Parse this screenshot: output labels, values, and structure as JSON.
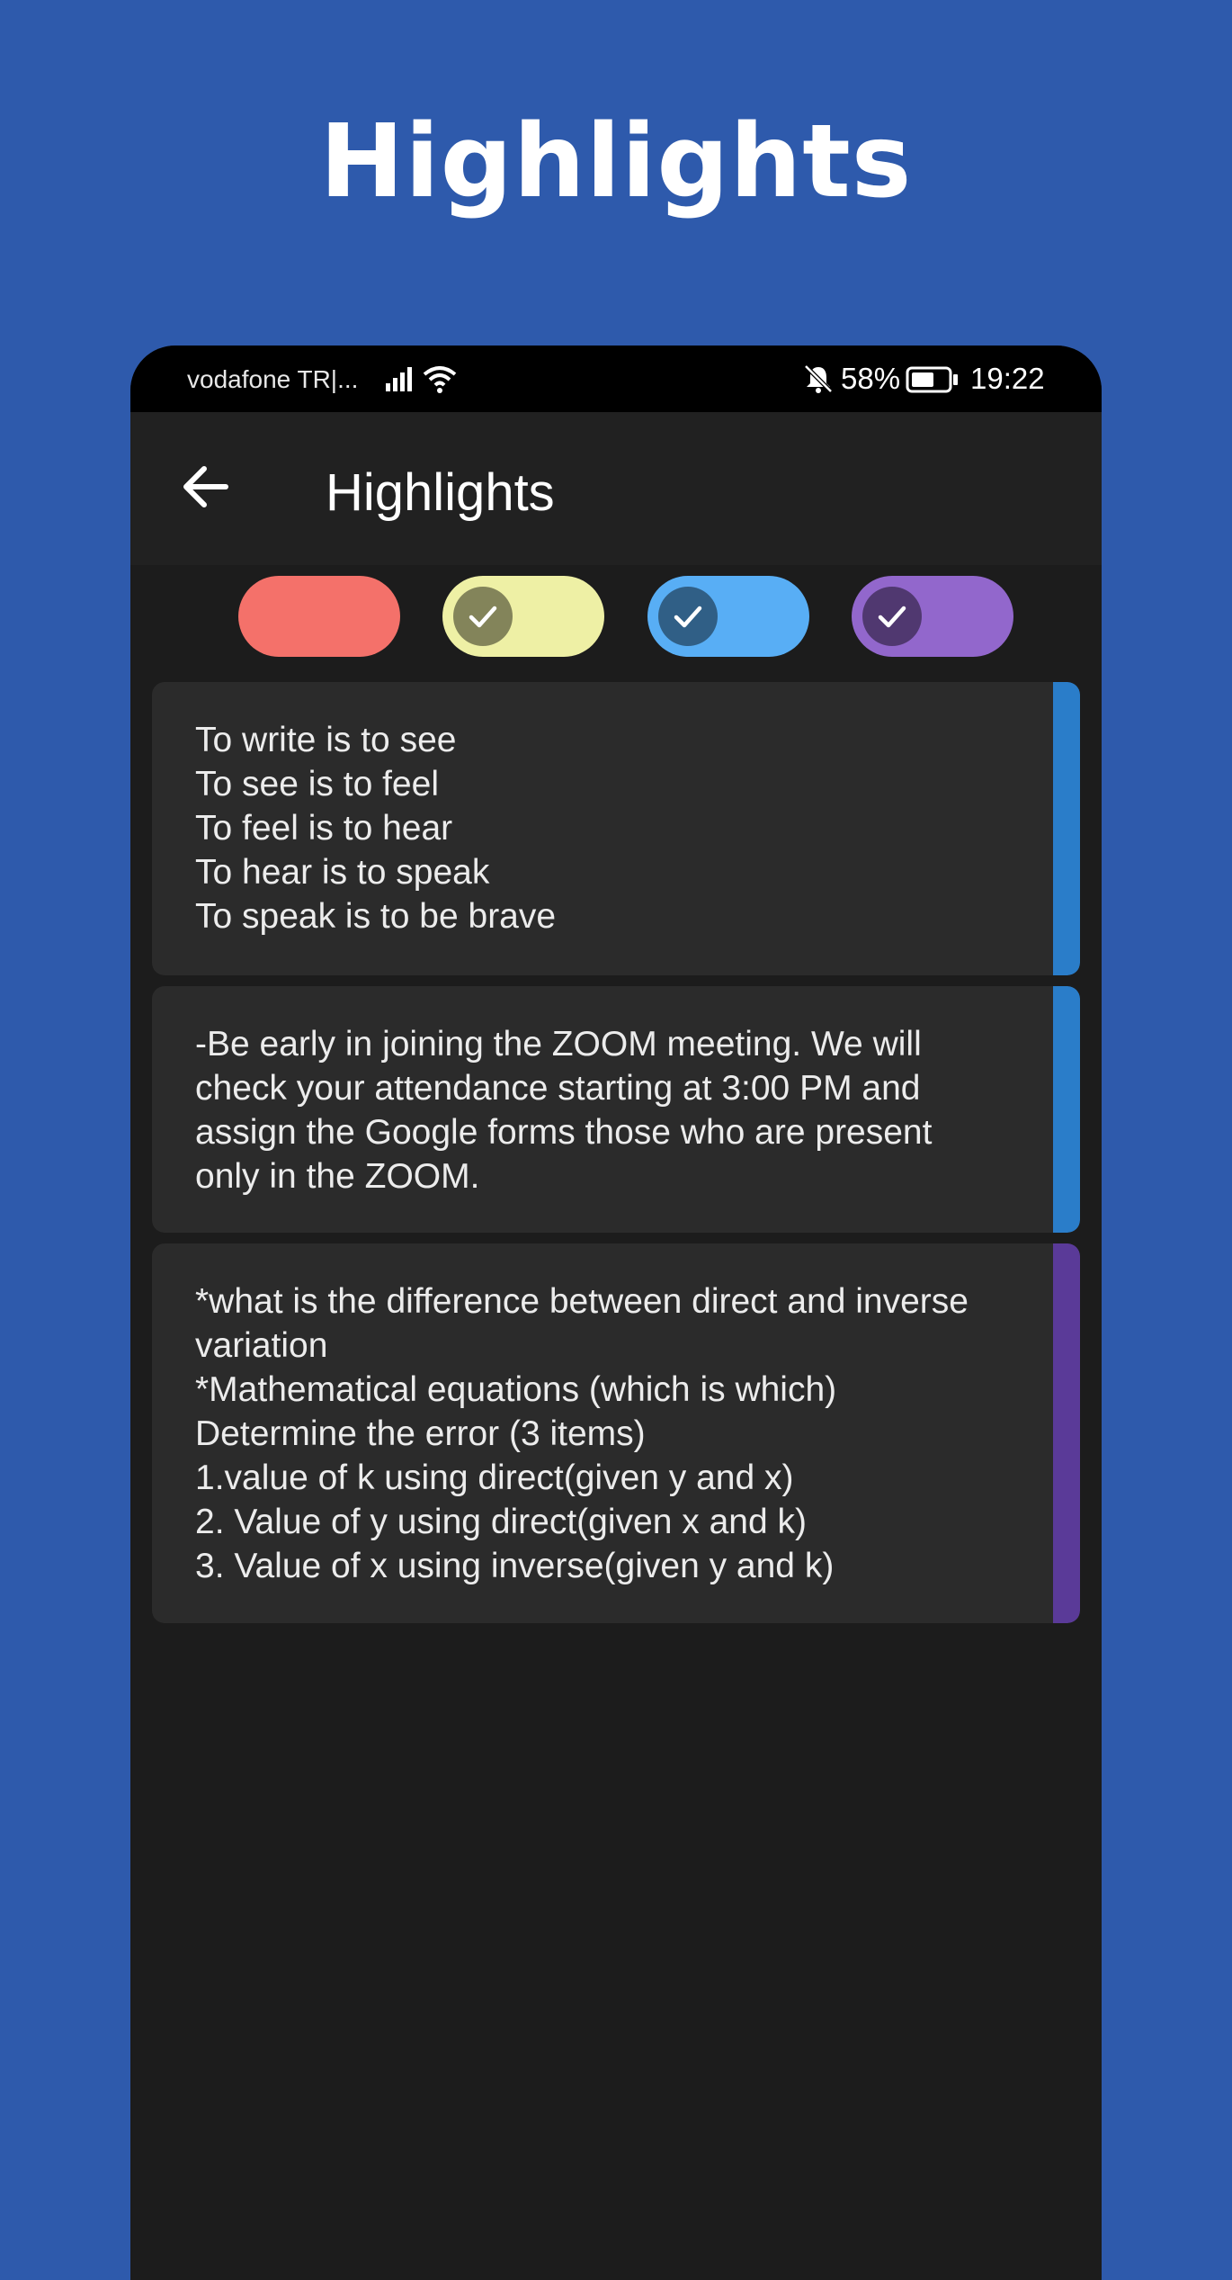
{
  "promo": {
    "title": "Highlights"
  },
  "status_bar": {
    "carrier": "vodafone TR|...",
    "battery": "58%",
    "time": "19:22",
    "icons": [
      "signal-icon",
      "wifi-icon",
      "bell-off-icon",
      "battery-icon"
    ]
  },
  "app_bar": {
    "title": "Highlights",
    "back_icon": "arrow-left-icon"
  },
  "color_filters": [
    {
      "name": "red",
      "color": "#f4716a",
      "selected": false
    },
    {
      "name": "yellow",
      "color": "#eef0a5",
      "selected": true
    },
    {
      "name": "blue",
      "color": "#58aef5",
      "selected": true
    },
    {
      "name": "purple",
      "color": "#9267cc",
      "selected": true
    }
  ],
  "highlights": [
    {
      "text": "To write is to see\nTo see is to feel\nTo feel is to hear\nTo hear is to speak\nTo speak is to be brave",
      "color": "#2a7dc9"
    },
    {
      "text": "-Be early in joining the ZOOM meeting. We will\ncheck your attendance starting at 3:00 PM and\nassign the Google forms those who are present\nonly in the ZOOM.",
      "color": "#2a7dc9"
    },
    {
      "text": "*what is the difference between direct and inverse\nvariation\n*Mathematical equations (which is which)\nDetermine the error (3 items)\n1.value of k using direct(given y and x)\n2. Value of y using direct(given x and k)\n3. Value of x using inverse(given y and k)",
      "color": "#5a3a98"
    }
  ]
}
